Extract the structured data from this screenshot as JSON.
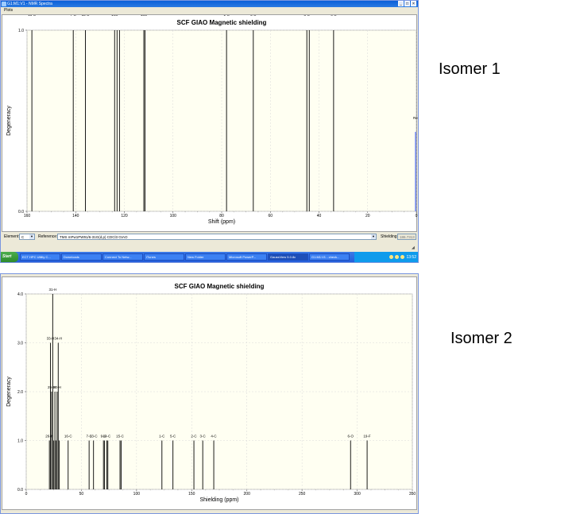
{
  "window": {
    "title": "G1:M1:V1 - NMR Spectra",
    "menu_plots": "Plots",
    "min_btn": "_",
    "max_btn": "□",
    "close_btn": "×"
  },
  "controls": {
    "element_label": "Element:",
    "element_value": "C",
    "reference_label": "Reference:",
    "reference_value": "TMS mPw1PW91/6-31G(d,p) CDCl3 GIAO",
    "shielding_label": "Shielding:",
    "shielding_value": "186.7313"
  },
  "taskbar": {
    "start": "Start",
    "items": [
      "ECT HPC Utility C...",
      "Downloads",
      "Connect To Netw...",
      "iTunes",
      "New Folder",
      "Microsoft PowerP...",
      "GaussView 5.0.8c",
      "G1:M1:V1 - check..."
    ],
    "clock": "13:52"
  },
  "isomer_labels": [
    "Isomer 1",
    "Isomer 2"
  ],
  "chart_data": [
    {
      "type": "bar",
      "title": "SCF GIAO Magnetic shielding",
      "xlabel": "Shift (ppm)",
      "ylabel": "Degeneracy",
      "xlim": [
        160,
        0
      ],
      "ylim": [
        0,
        1.0
      ],
      "x_ticks": [
        "160",
        "140",
        "120",
        "100",
        "80",
        "60",
        "40",
        "20",
        "0"
      ],
      "y_ticks": [
        "0.0",
        "1.0"
      ],
      "grid": true,
      "reference_marker": {
        "x": 0,
        "value": 0.5,
        "label": "Re",
        "color": "#4f6df5"
      },
      "peaks": [
        {
          "label": "16-C",
          "x": 158,
          "value": 1
        },
        {
          "label": "7-C",
          "x": 141,
          "value": 1
        },
        {
          "label": "13-C",
          "x": 136,
          "value": 1
        },
        {
          "label": "14C",
          "x": 124,
          "value": 1
        },
        {
          "label": "",
          "x": 123,
          "value": 1
        },
        {
          "label": "",
          "x": 122,
          "value": 1
        },
        {
          "label": "15C",
          "x": 112,
          "value": 1
        },
        {
          "label": "",
          "x": 111.5,
          "value": 1
        },
        {
          "label": "1-C",
          "x": 78,
          "value": 1
        },
        {
          "label": "5-C",
          "x": 67,
          "value": 1
        },
        {
          "label": "3-C",
          "x": 45,
          "value": 1
        },
        {
          "label": "",
          "x": 44,
          "value": 1
        },
        {
          "label": "4-C",
          "x": 34,
          "value": 1
        }
      ]
    },
    {
      "type": "bar",
      "title": "SCF GIAO Magnetic shielding",
      "xlabel": "Shielding (ppm)",
      "ylabel": "Degeneracy",
      "xlim": [
        0,
        350
      ],
      "ylim": [
        0,
        4.0
      ],
      "x_ticks": [
        "0",
        "50",
        "100",
        "150",
        "200",
        "250",
        "300",
        "350"
      ],
      "y_ticks": [
        "0.0",
        "1.0",
        "2.0",
        "3.0",
        "4.0"
      ],
      "grid": true,
      "peaks": [
        {
          "label": "31-H",
          "x": 24,
          "value": 4
        },
        {
          "label": "33-H",
          "x": 22,
          "value": 3
        },
        {
          "label": "34-H",
          "x": 29,
          "value": 3
        },
        {
          "label": "25-H",
          "x": 23,
          "value": 2
        },
        {
          "label": "",
          "x": 26,
          "value": 2
        },
        {
          "label": "30-H",
          "x": 28,
          "value": 2
        },
        {
          "label": "26-H",
          "x": 21,
          "value": 1
        },
        {
          "label": "",
          "x": 25,
          "value": 1
        },
        {
          "label": "",
          "x": 27,
          "value": 1
        },
        {
          "label": "",
          "x": 30,
          "value": 1
        },
        {
          "label": "16-C",
          "x": 38,
          "value": 1
        },
        {
          "label": "7-C",
          "x": 57,
          "value": 1
        },
        {
          "label": "13-C",
          "x": 61,
          "value": 1
        },
        {
          "label": "9-C",
          "x": 70,
          "value": 1
        },
        {
          "label": "",
          "x": 71,
          "value": 1
        },
        {
          "label": "14-C",
          "x": 73,
          "value": 1
        },
        {
          "label": "",
          "x": 74,
          "value": 1
        },
        {
          "label": "15-C",
          "x": 85,
          "value": 1
        },
        {
          "label": "",
          "x": 86,
          "value": 1
        },
        {
          "label": "1-C",
          "x": 123,
          "value": 1
        },
        {
          "label": "5-C",
          "x": 133,
          "value": 1
        },
        {
          "label": "2-C",
          "x": 152,
          "value": 1
        },
        {
          "label": "3-C",
          "x": 160,
          "value": 1
        },
        {
          "label": "4-C",
          "x": 170,
          "value": 1
        },
        {
          "label": "6-O",
          "x": 294,
          "value": 1
        },
        {
          "label": "19-F",
          "x": 309,
          "value": 1
        }
      ]
    }
  ]
}
